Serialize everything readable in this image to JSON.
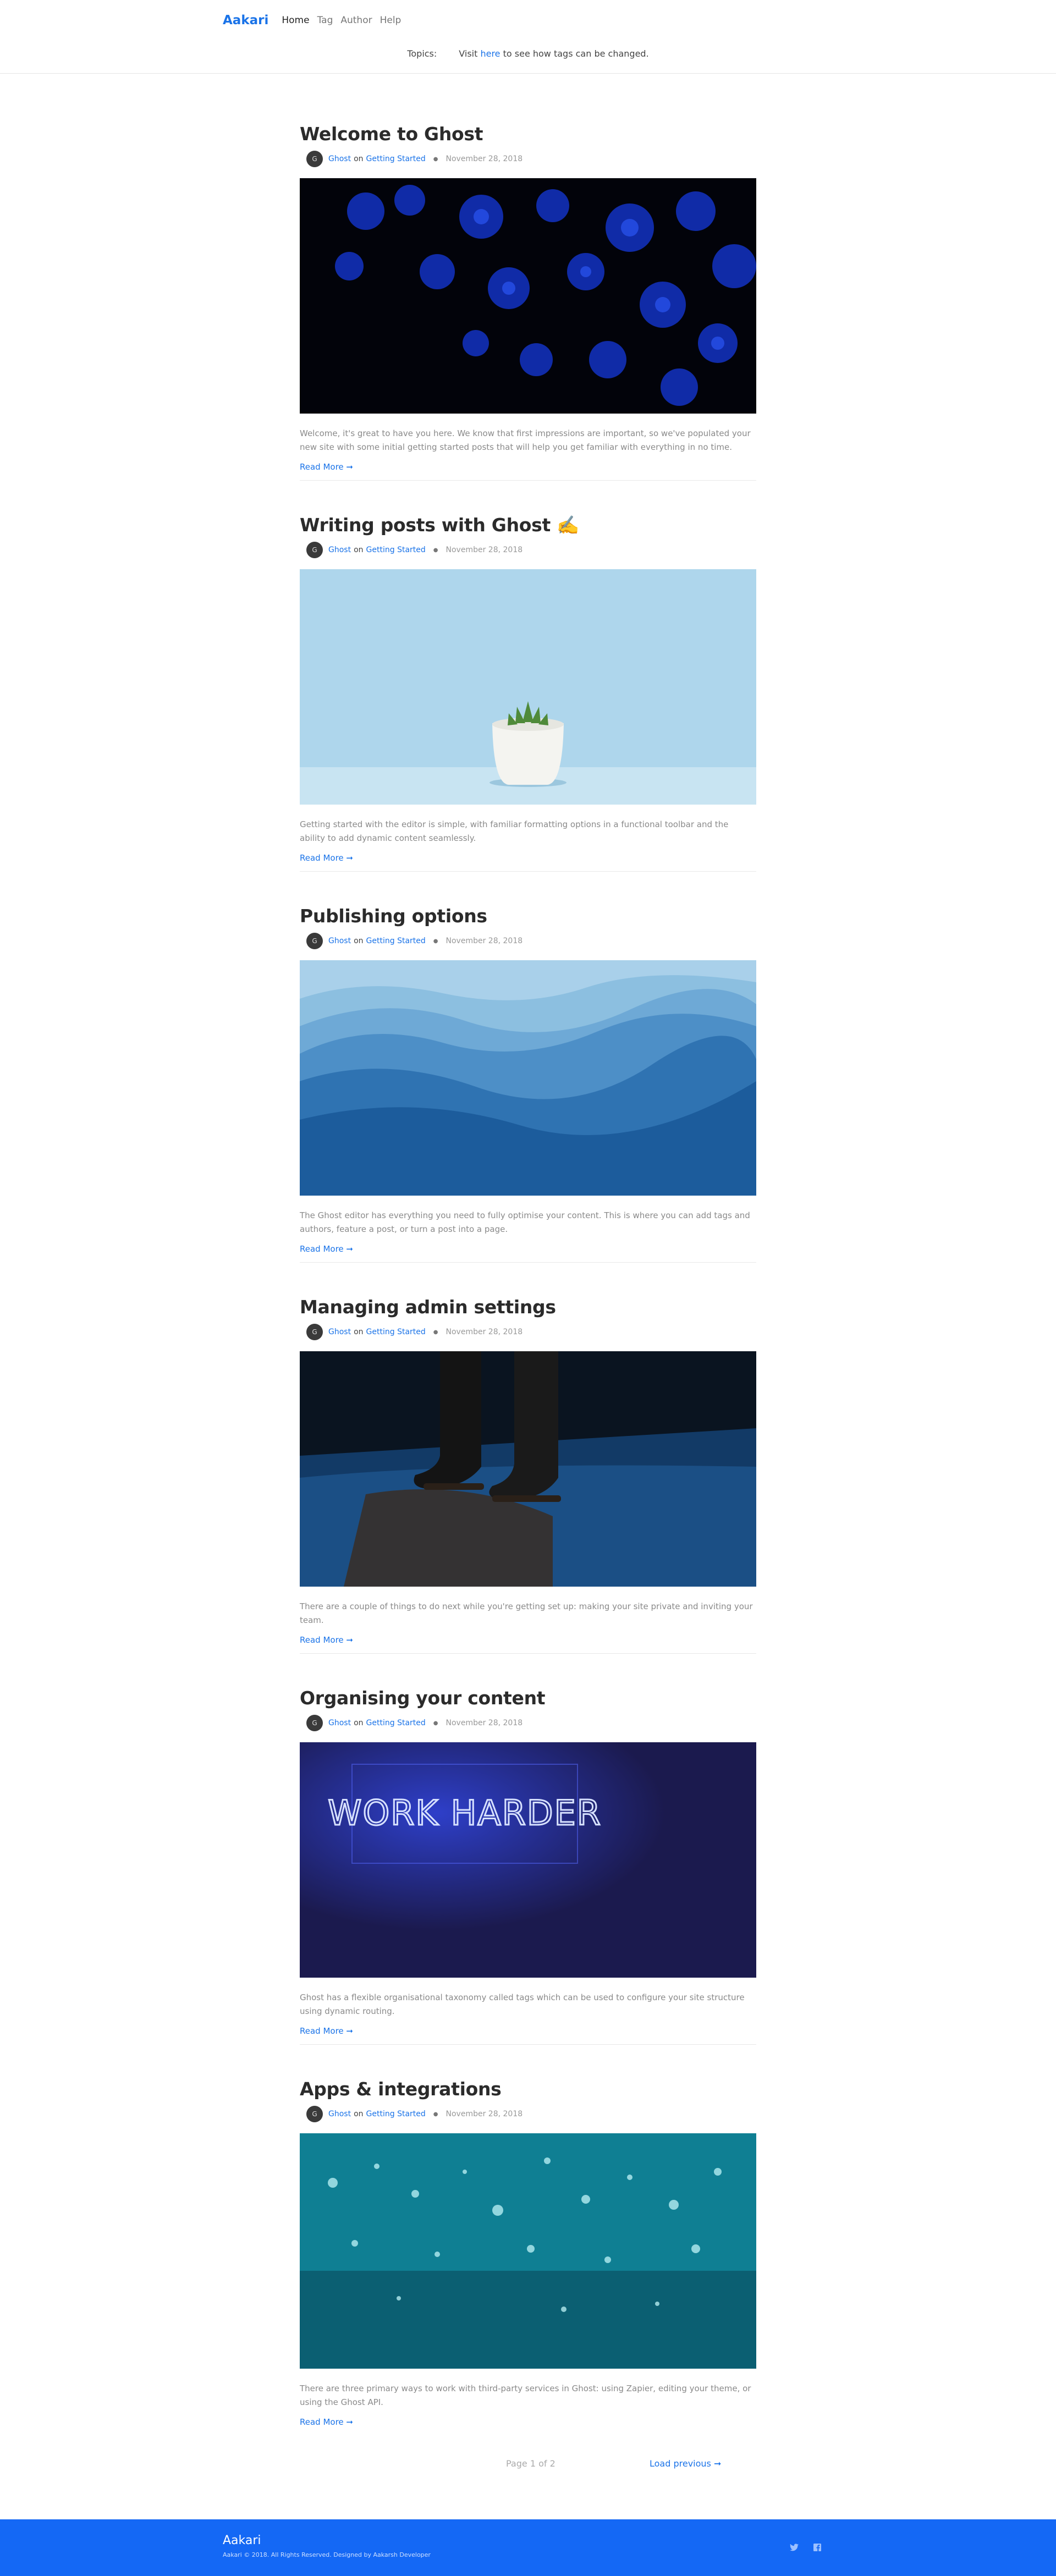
{
  "header": {
    "brand": "Aakari",
    "nav": [
      {
        "label": "Home"
      },
      {
        "label": "Tag"
      },
      {
        "label": "Author"
      },
      {
        "label": "Help"
      }
    ],
    "topics_label": "Topics:",
    "topics_text_before": "Visit ",
    "topics_link": "here",
    "topics_text_after": " to see how tags can be changed."
  },
  "posts": [
    {
      "title": "Welcome to Ghost",
      "author": "Ghost",
      "on": "on",
      "tag": "Getting Started",
      "date": "November 28, 2018",
      "excerpt": "Welcome, it's great to have you here. We know that first impressions are important, so we've populated your new site with some initial getting started posts that will help you get familiar with everything in no time.",
      "read_more": "Read More ➞"
    },
    {
      "title": "Writing posts with Ghost ✍️",
      "author": "Ghost",
      "on": "on",
      "tag": "Getting Started",
      "date": "November 28, 2018",
      "excerpt": "Getting started with the editor is simple, with familiar formatting options in a functional toolbar and the ability to add dynamic content seamlessly.",
      "read_more": "Read More ➞"
    },
    {
      "title": "Publishing options",
      "author": "Ghost",
      "on": "on",
      "tag": "Getting Started",
      "date": "November 28, 2018",
      "excerpt": "The Ghost editor has everything you need to fully optimise your content. This is where you can add tags and authors, feature a post, or turn a post into a page.",
      "read_more": "Read More ➞"
    },
    {
      "title": "Managing admin settings",
      "author": "Ghost",
      "on": "on",
      "tag": "Getting Started",
      "date": "November 28, 2018",
      "excerpt": "There are a couple of things to do next while you're getting set up: making your site private and inviting your team.",
      "read_more": "Read More ➞"
    },
    {
      "title": "Organising your content",
      "author": "Ghost",
      "on": "on",
      "tag": "Getting Started",
      "date": "November 28, 2018",
      "excerpt": "Ghost has a flexible organisational taxonomy called tags which can be used to configure your site structure using dynamic routing.",
      "read_more": "Read More ➞",
      "image_sign_text": "WORK HARDER"
    },
    {
      "title": "Apps & integrations",
      "author": "Ghost",
      "on": "on",
      "tag": "Getting Started",
      "date": "November 28, 2018",
      "excerpt": "There are three primary ways to work with third-party services in Ghost: using Zapier, editing your theme, or using the Ghost API.",
      "read_more": "Read More ➞"
    }
  ],
  "pagination": {
    "page_label": "Page 1 of 2",
    "load_previous": "Load previous ➞"
  },
  "footer": {
    "brand": "Aakari",
    "copyright": "Aakari © 2018. All Rights Reserved. Designed by Aakarsh Developer"
  },
  "colors": {
    "accent": "#1a73e8",
    "footer_bg": "#1468f5"
  },
  "icons": [
    "twitter-icon",
    "facebook-icon"
  ]
}
